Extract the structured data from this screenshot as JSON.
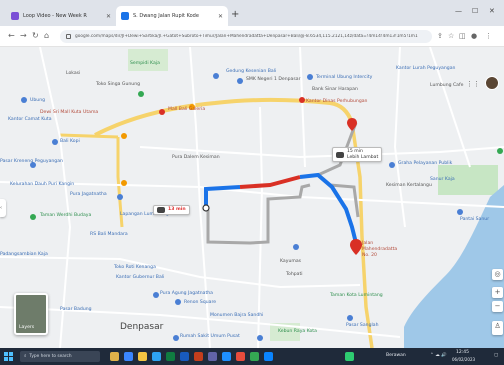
{
  "browser": {
    "tabs": [
      {
        "title": "Loop Video - New Week R",
        "active": false,
        "favicon_color": "#7a4fd6"
      },
      {
        "title": "S. Dwang Jalan Rupit Kode",
        "active": true,
        "favicon_color": "#1a73e8"
      }
    ],
    "new_tab_label": "+",
    "window_controls": {
      "minimize": "—",
      "maximize": "☐",
      "close": "✕"
    },
    "url": "google.com/maps/dir/Jl+Dewi+Sartika/Jl.+Gatot+Subroto+Timur/Jalan+Mahendradatta+Denpasar+Bali/@-8.6534,115.2121,14z/data=!4m14!4m13!1m5!1m1"
  },
  "map": {
    "labels": [
      {
        "id": "l1",
        "text": "Lokasi",
        "color": "gray"
      },
      {
        "id": "l2",
        "text": "Sempidi Kaja",
        "color": "green"
      },
      {
        "id": "l3",
        "text": "Toko Singa Gunung",
        "color": "gray"
      },
      {
        "id": "l4",
        "text": "SMK Negeri 1 Denpasar",
        "color": "gray"
      },
      {
        "id": "l5",
        "text": "Ubung",
        "color": "blue"
      },
      {
        "id": "l6",
        "text": "Pasar Kreneng Peguyangan",
        "color": "blue"
      },
      {
        "id": "l7",
        "text": "Bali Kopi",
        "color": "blue"
      },
      {
        "id": "l8",
        "text": "Terminal Ubung Intercity",
        "color": "blue"
      },
      {
        "id": "l9",
        "text": "Bank Sinar Harapan",
        "color": "gray"
      },
      {
        "id": "l10",
        "text": "Graha Pelayanan Publik",
        "color": "blue"
      },
      {
        "id": "l11",
        "text": "Kantor Lurah Peguyangan",
        "color": "blue"
      },
      {
        "id": "l12",
        "text": "Gedung Kesenian Bali",
        "color": "blue"
      },
      {
        "id": "l13",
        "text": "Lumbung Cafe",
        "color": "gray"
      },
      {
        "id": "l14",
        "text": "Pantai Sanur",
        "color": "blue"
      },
      {
        "id": "l15",
        "text": "Kantor Camat Kuta",
        "color": "blue"
      },
      {
        "id": "l16",
        "text": "Kelurahan Dauh Puri Kangin",
        "color": "blue"
      },
      {
        "id": "l17",
        "text": "Pura Jagatnatha",
        "color": "blue"
      },
      {
        "id": "l18",
        "text": "Taman Werdhi Budaya",
        "color": "green"
      },
      {
        "id": "l19",
        "text": "Lapangan Lumintang",
        "color": "blue"
      },
      {
        "id": "l20",
        "text": "RS Bali Mandara",
        "color": "blue"
      },
      {
        "id": "l21",
        "text": "Padangsambian Kaja",
        "color": "blue"
      },
      {
        "id": "l22",
        "text": "Pura Dalem Kesiman",
        "color": "gray"
      },
      {
        "id": "l23",
        "text": "Toko Roti Kenanga",
        "color": "blue"
      },
      {
        "id": "l24",
        "text": "Kayumas",
        "color": "gray"
      },
      {
        "id": "l25",
        "text": "Kantor Gubernur Bali",
        "color": "blue"
      },
      {
        "id": "l26",
        "text": "Pura Agung Jagatnatha",
        "color": "blue"
      },
      {
        "id": "l27",
        "text": "Tohpati",
        "color": "gray"
      },
      {
        "id": "l28",
        "text": "Kesiman Kertalangu",
        "color": "gray"
      },
      {
        "id": "l29",
        "text": "Renon Square",
        "color": "blue"
      },
      {
        "id": "l30",
        "text": "Monumen Bajra Sandhi",
        "color": "blue"
      },
      {
        "id": "l31",
        "text": "Denpasar",
        "color": "big"
      },
      {
        "id": "l32",
        "text": "Rumah Sakit Umum Pusat",
        "color": "blue"
      },
      {
        "id": "l33",
        "text": "Kebun Raya Kota",
        "color": "green"
      },
      {
        "id": "l34",
        "text": "Taman Kota Lumintang",
        "color": "green"
      },
      {
        "id": "l35",
        "text": "Pasar Badung",
        "color": "blue"
      },
      {
        "id": "l36",
        "text": "Pasar Sanglah",
        "color": "blue"
      },
      {
        "id": "l37",
        "text": "Sanur Kaja",
        "color": "blue"
      }
    ],
    "poi_red": [
      {
        "id": "r1",
        "text": "Dewi Sri Mall Kuta Utama",
        "color": "red"
      },
      {
        "id": "r2",
        "text": "Mall Bali Galeria",
        "color": "red"
      },
      {
        "id": "r3",
        "text": "Kantor Dinas Perhubungan",
        "color": "red"
      }
    ],
    "route_card_1": {
      "duration": "13 min",
      "distance": "4.6 km"
    },
    "route_card_2": {
      "duration": "15 min",
      "distance": "Lebih Lambat"
    },
    "destination_label": "Jalan Mahendradatta No. 20",
    "layers_label": "Layers",
    "zoom": {
      "in": "+",
      "out": "−"
    },
    "side_toggle": "‹"
  },
  "taskbar": {
    "search_placeholder": "Type here to search",
    "tray_weather": "Berawan",
    "tray_time": "12:45",
    "tray_date": "06/02/2023"
  },
  "colors": {
    "route_blue": "#1a73e8",
    "route_red": "#d93025",
    "route_alt": "#a8a8a8",
    "road_yellow": "#f6d36b",
    "water": "#9fc8e8",
    "park": "#c7e6c4"
  }
}
